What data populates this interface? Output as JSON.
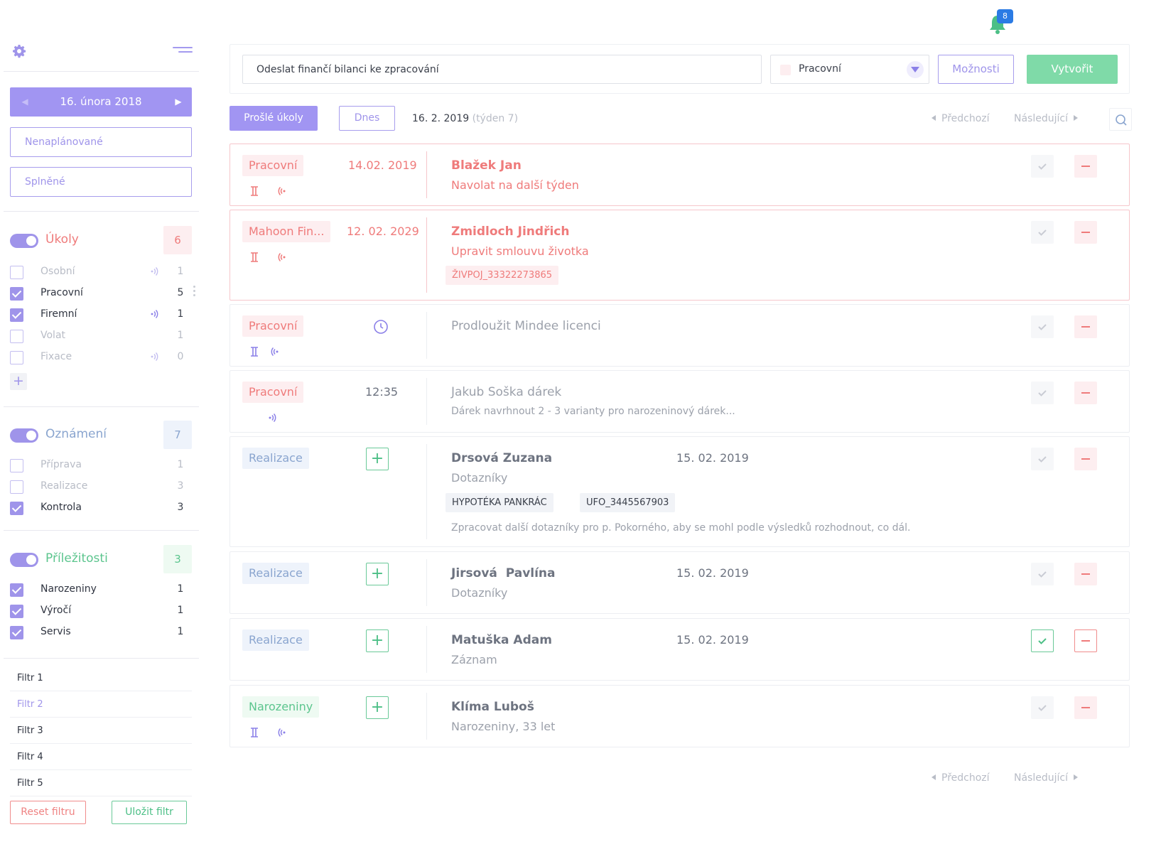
{
  "notifications": {
    "count": "8"
  },
  "sidebar": {
    "date": "16. února 2018",
    "unscheduled": "Nenaplánované",
    "completed": "Splněné",
    "groups": [
      {
        "title": "Úkoly",
        "count": "6",
        "color": "#ef7b7b",
        "items": [
          {
            "label": "Osobní",
            "count": "1",
            "checked": false
          },
          {
            "label": "Pracovní",
            "count": "5",
            "checked": true
          },
          {
            "label": "Firemní",
            "count": "1",
            "checked": true
          },
          {
            "label": "Volat",
            "count": "1",
            "checked": false
          },
          {
            "label": "Fixace",
            "count": "0",
            "checked": false
          }
        ]
      },
      {
        "title": "Oznámení",
        "count": "7",
        "color": "#8aa5cf",
        "items": [
          {
            "label": "Příprava",
            "count": "1",
            "checked": false
          },
          {
            "label": "Realizace",
            "count": "3",
            "checked": false
          },
          {
            "label": "Kontrola",
            "count": "3",
            "checked": true
          }
        ]
      },
      {
        "title": "Příležitosti",
        "count": "3",
        "color": "#5cc58e",
        "items": [
          {
            "label": "Narozeniny",
            "count": "1",
            "checked": true
          },
          {
            "label": "Výročí",
            "count": "1",
            "checked": true
          },
          {
            "label": "Servis",
            "count": "1",
            "checked": true
          }
        ]
      }
    ],
    "filters": [
      "Filtr 1",
      "Filtr 2",
      "Filtr 3",
      "Filtr 4",
      "Filtr 5"
    ],
    "reset_label": "Reset filtru",
    "save_label": "Uložit filtr"
  },
  "create": {
    "task_value": "Odeslat finančí bilanci ke zpracování",
    "type_value": "Pracovní",
    "options_label": "Možnosti",
    "create_label": "Vytvořit"
  },
  "toolbar": {
    "expired_label": "Prošlé úkoly",
    "today_label": "Dnes",
    "date": "16. 2. 2019",
    "week": "(týden 7)",
    "prev_label": "Předchozí",
    "next_label": "Následující"
  },
  "tasks": [
    {
      "tag": "Pracovní",
      "date": "14.02. 2019",
      "name": "Blažek Jan",
      "sub": "Navolat na další týden"
    },
    {
      "tag": "Mahoon Fin...",
      "date": "12. 02. 2029",
      "name": "Zmidloch Jindřich",
      "sub": "Upravit smlouvu životka",
      "chips": [
        "ŽIVPOJ_33322273865"
      ]
    },
    {
      "tag": "Pracovní",
      "name": "Prodloužit Mindee licenci"
    },
    {
      "tag": "Pracovní",
      "time": "12:35",
      "name": "Jakub Soška dárek",
      "note": "Dárek navrhnout 2 - 3 varianty pro narozeninový dárek..."
    },
    {
      "tag": "Realizace",
      "name": "Drsová Zuzana",
      "date2": "15. 02. 2019",
      "sub": "Dotazníky",
      "chips": [
        "HYPOTÉKA PANKRÁC",
        "UFO_3445567903"
      ],
      "note": "Zpracovat další dotazníky pro p. Pokorného, aby se mohl podle výsledků rozhodnout, co dál."
    },
    {
      "tag": "Realizace",
      "name": "Jirsová  Pavlína",
      "date2": "15. 02. 2019",
      "sub": "Dotazníky"
    },
    {
      "tag": "Realizace",
      "name": "Matuška Adam",
      "date2": "15. 02. 2019",
      "sub": "Záznam"
    },
    {
      "tag": "Narozeniny",
      "name": "Klíma Luboš",
      "sub": "Narozeniny, 33 let"
    }
  ],
  "colors": {
    "accent": "#a195f2",
    "red": "#ef7b7b",
    "green": "#5cc58e",
    "blue": "#8aa5cf"
  }
}
